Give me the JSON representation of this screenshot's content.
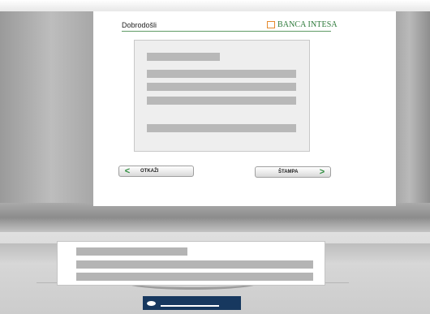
{
  "screen": {
    "header_title": "Dobrodošli",
    "bank_name": "BANCA INTESA",
    "buttons": {
      "cancel_label": "OTKAŽI",
      "print_label": "ŠTAMPA"
    }
  },
  "colors": {
    "accent_green": "#2a8a3a",
    "logo_orange": "#e58a2e",
    "card_slot": "#17385f"
  },
  "icons": {
    "back": "chevron-left-icon",
    "forward": "chevron-right-icon",
    "card_reader": "card-reader-light-icon"
  }
}
